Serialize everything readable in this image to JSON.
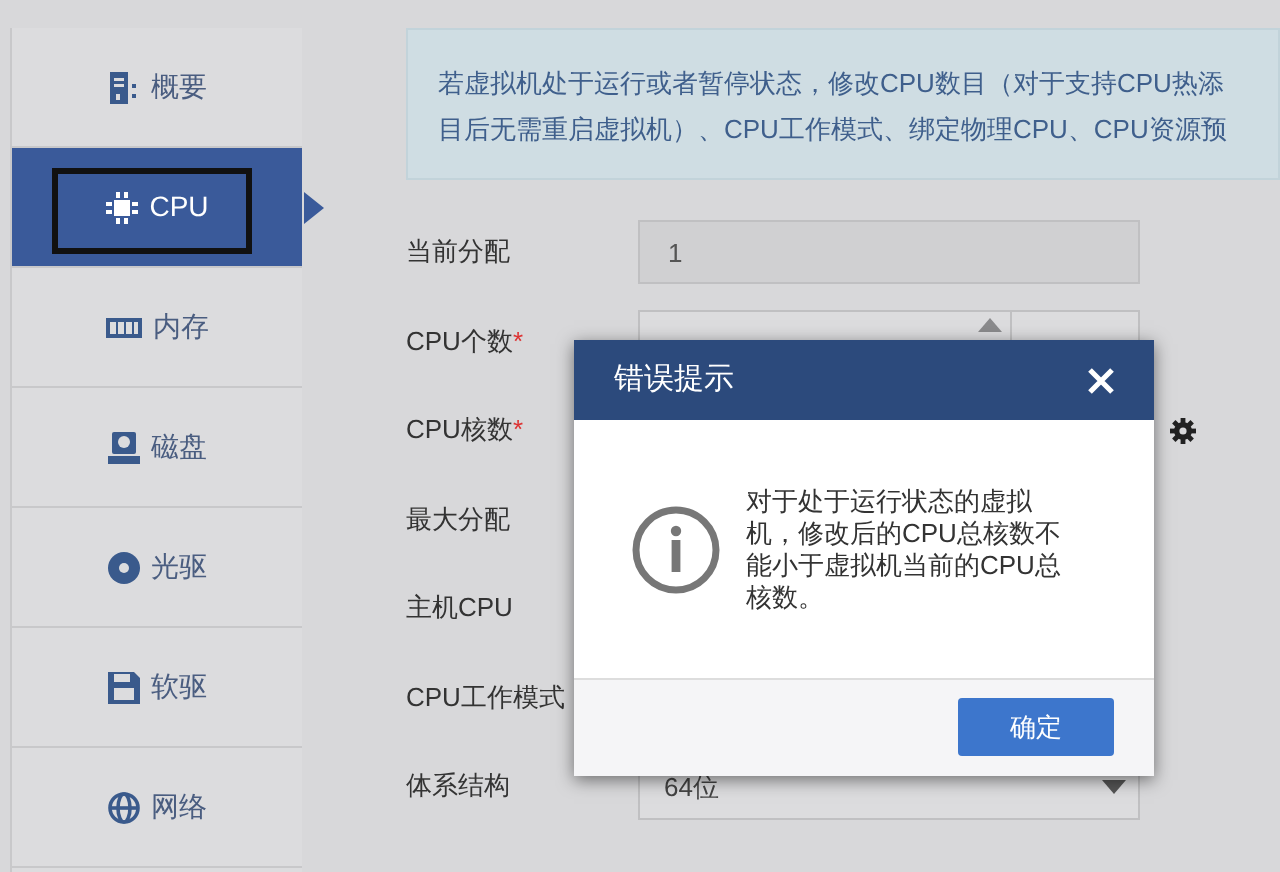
{
  "sidebar": {
    "items": [
      {
        "label": "概要",
        "selected": false
      },
      {
        "label": "CPU",
        "selected": true
      },
      {
        "label": "内存",
        "selected": false
      },
      {
        "label": "磁盘",
        "selected": false
      },
      {
        "label": "光驱",
        "selected": false
      },
      {
        "label": "软驱",
        "selected": false
      },
      {
        "label": "网络",
        "selected": false
      }
    ]
  },
  "notice": {
    "lines": [
      "若虚拟机处于运行或者暂停状态，修改CPU数目（对于支持CPU热添",
      "目后无需重启虚拟机）、CPU工作模式、绑定物理CPU、CPU资源预"
    ]
  },
  "form": {
    "fields": [
      {
        "label": "当前分配",
        "kind": "readonly",
        "value": "1"
      },
      {
        "label": "CPU个数",
        "required_mark": "*",
        "kind": "spinner"
      },
      {
        "label": "CPU核数",
        "required_mark": "*",
        "kind": "covered",
        "has_settings": true
      },
      {
        "label": "最大分配",
        "kind": "covered"
      },
      {
        "label": "主机CPU",
        "kind": "covered"
      },
      {
        "label": "CPU工作模式",
        "kind": "covered"
      },
      {
        "label": "体系结构",
        "kind": "select",
        "value": "64位"
      }
    ]
  },
  "dialog": {
    "title": "错误提示",
    "message": "对于处于运行状态的虚拟机，修改后的CPU总核数不能小于虚拟机当前的CPU总核数。",
    "buttons": [
      "确定"
    ]
  }
}
